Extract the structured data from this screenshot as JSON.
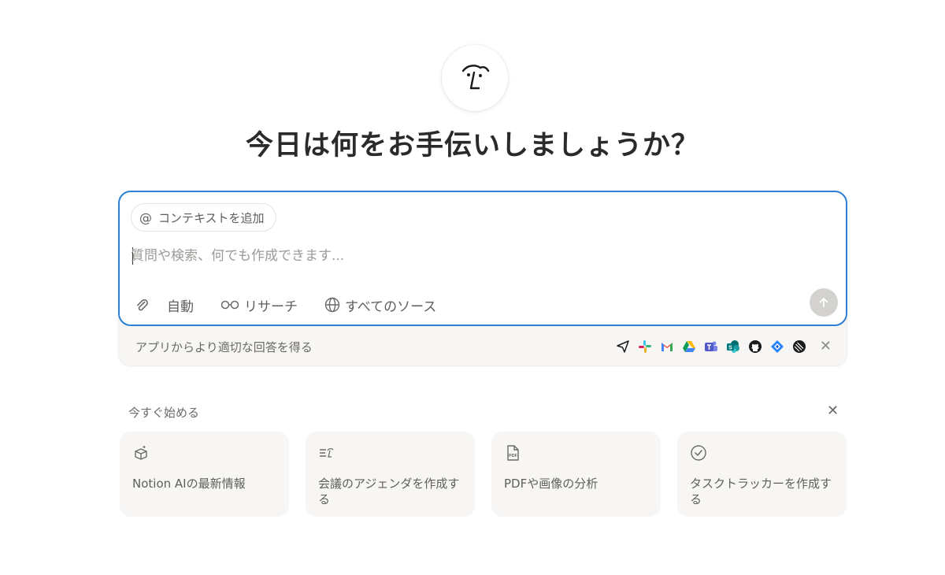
{
  "headline": "今日は何をお手伝いしましょうか？",
  "prompt": {
    "context_chip_label": "コンテキストを追加",
    "placeholder": "質問や検索、何でも作成できます...",
    "toolbar": {
      "auto_label": "自動",
      "research_label": "リサーチ",
      "sources_label": "すべてのソース"
    }
  },
  "footer": {
    "text": "アプリからより適切な回答を得る",
    "apps": [
      "send-icon",
      "slack-icon",
      "gmail-icon",
      "google-drive-icon",
      "teams-icon",
      "sharepoint-icon",
      "github-icon",
      "jira-icon",
      "linear-icon"
    ]
  },
  "suggestions": {
    "title": "今すぐ始める",
    "cards": [
      {
        "icon": "box-sparkle-icon",
        "label": "Notion AIの最新情報"
      },
      {
        "icon": "agenda-icon",
        "label": "会議のアジェンダを作成する"
      },
      {
        "icon": "pdf-icon",
        "label": "PDFや画像の分析"
      },
      {
        "icon": "check-circle-icon",
        "label": "タスクトラッカーを作成する"
      }
    ]
  },
  "colors": {
    "accent_border": "#2d7fd3",
    "send_disabled": "#d3d2cf",
    "card_bg": "#f7f6f4"
  }
}
